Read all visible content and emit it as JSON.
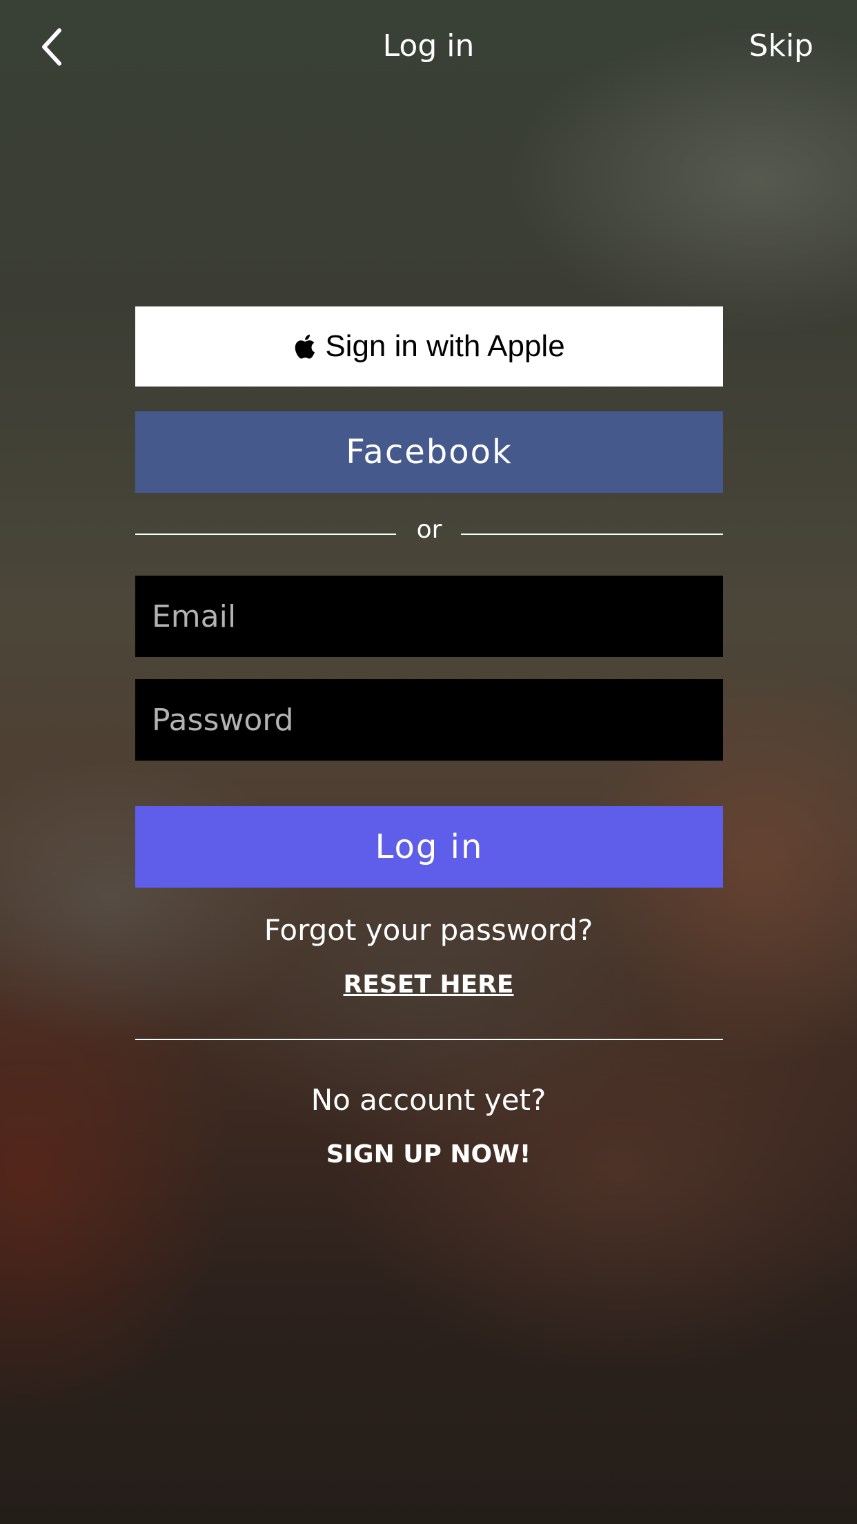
{
  "header": {
    "back_icon": "back-chevron-icon",
    "title": "Log in",
    "skip_label": "Skip"
  },
  "social": {
    "apple_icon": "apple-logo-icon",
    "apple_label": "Sign in with Apple",
    "facebook_label": "Facebook"
  },
  "divider": {
    "or_label": "or"
  },
  "form": {
    "email_placeholder": "Email",
    "email_value": "",
    "password_placeholder": "Password",
    "password_value": "",
    "login_label": "Log in"
  },
  "forgot": {
    "prompt": "Forgot your password?",
    "link_label": "RESET HERE"
  },
  "signup": {
    "prompt": "No account yet?",
    "link_label": "SIGN UP NOW!"
  },
  "colors": {
    "facebook": "#45598d",
    "login": "#5e5eea",
    "apple_button": "#ffffff",
    "field_background": "#000000"
  }
}
